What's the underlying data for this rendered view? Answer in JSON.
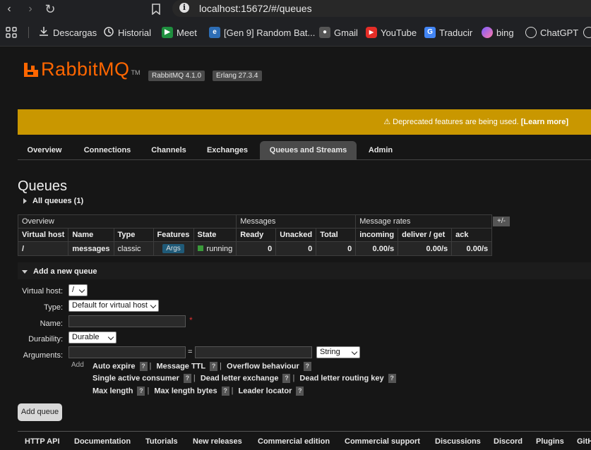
{
  "browser": {
    "url": "localhost:15672/#/queues",
    "bookmarks": [
      {
        "label": "",
        "icon": "apps-grid-icon"
      },
      {
        "label": "Descargas",
        "icon": "download-icon"
      },
      {
        "label": "Historial",
        "icon": "history-icon"
      },
      {
        "label": "Meet",
        "icon": "meet-icon"
      },
      {
        "label": "[Gen 9] Random Bat...",
        "icon": "edge-page-icon"
      },
      {
        "label": "Gmail",
        "icon": "gmail-icon"
      },
      {
        "label": "YouTube",
        "icon": "youtube-icon"
      },
      {
        "label": "Traducir",
        "icon": "translate-icon"
      },
      {
        "label": "bing",
        "icon": "copilot-icon"
      },
      {
        "label": "ChatGPT",
        "icon": "chatgpt-icon"
      }
    ]
  },
  "header": {
    "brand": "RabbitMQ",
    "tm": "TM",
    "version_rabbit": "RabbitMQ 4.1.0",
    "version_erlang": "Erlang 27.3.4"
  },
  "banner": {
    "text": "⚠ Deprecated features are being used.",
    "link": "[Learn more]"
  },
  "tabs": [
    "Overview",
    "Connections",
    "Channels",
    "Exchanges",
    "Queues and Streams",
    "Admin"
  ],
  "page_title": "Queues",
  "all_queues_label": "All queues (1)",
  "table": {
    "group_headers": [
      "Overview",
      "Messages",
      "Message rates"
    ],
    "plus_minus": "+/-",
    "columns": [
      "Virtual host",
      "Name",
      "Type",
      "Features",
      "State",
      "Ready",
      "Unacked",
      "Total",
      "incoming",
      "deliver / get",
      "ack"
    ],
    "row": {
      "vhost": "/",
      "name": "messages",
      "type": "classic",
      "features": "Args",
      "state": "running",
      "ready": "0",
      "unacked": "0",
      "total": "0",
      "incoming": "0.00/s",
      "deliver_get": "0.00/s",
      "ack": "0.00/s"
    }
  },
  "add_queue": {
    "heading": "Add a new queue",
    "labels": {
      "vhost": "Virtual host:",
      "type": "Type:",
      "name": "Name:",
      "durability": "Durability:",
      "arguments": "Arguments:"
    },
    "vhost_value": "/",
    "type_value": "Default for virtual host",
    "durability_value": "Durable",
    "arg_type_value": "String",
    "equals": "=",
    "required_mark": "*",
    "add_label": "Add",
    "help_q": "?",
    "helpers_row1": [
      "Auto expire",
      "Message TTL",
      "Overflow behaviour"
    ],
    "helpers_row2": [
      "Single active consumer",
      "Dead letter exchange",
      "Dead letter routing key"
    ],
    "helpers_row3": [
      "Max length",
      "Max length bytes",
      "Leader locator"
    ],
    "submit": "Add queue"
  },
  "footer": [
    "HTTP API",
    "Documentation",
    "Tutorials",
    "New releases",
    "Commercial edition",
    "Commercial support",
    "Discussions",
    "Discord",
    "Plugins",
    "GitH"
  ]
}
